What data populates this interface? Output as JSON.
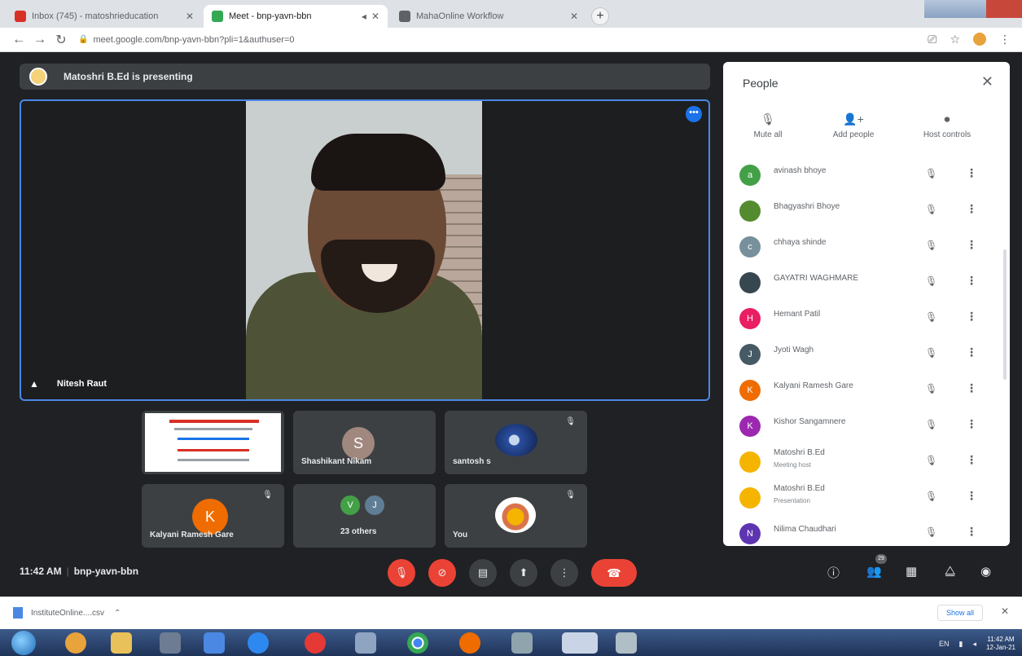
{
  "browser": {
    "tabs": [
      {
        "title": "Inbox (745) - matoshrieducation",
        "favicon_color": "#d93025",
        "active": false
      },
      {
        "title": "Meet - bnp-yavn-bbn",
        "favicon_color": "#34a853",
        "active": true
      },
      {
        "title": "MahaOnline Workflow",
        "favicon_color": "#5f6368",
        "active": false
      }
    ],
    "new_tab": "+",
    "url": "meet.google.com/bnp-yavn-bbn?pli=1&authuser=0"
  },
  "meet": {
    "presenting_text": "Matoshri B.Ed is presenting",
    "main_video_name": "Nitesh Raut",
    "tiles": [
      {
        "name": "",
        "kind": "slide"
      },
      {
        "name": "Shashikant Nikam",
        "initial": "S",
        "avatar_color": "#a1887f"
      },
      {
        "name": "santosh s",
        "kind": "photo"
      },
      {
        "name": "Kalyani Ramesh Gare",
        "initial": "K",
        "avatar_color": "#ef6c00"
      },
      {
        "name": "23 others",
        "initials": [
          "V",
          "J"
        ]
      },
      {
        "name": "You",
        "kind": "photo"
      }
    ],
    "time": "11:42 AM",
    "separator": "|",
    "meeting_code": "bnp-yavn-bbn",
    "participant_count": "29"
  },
  "people_panel": {
    "title": "People",
    "actions": [
      {
        "label": "Mute all",
        "icon": "mic-off-icon"
      },
      {
        "label": "Add people",
        "icon": "add-person-icon"
      },
      {
        "label": "Host controls",
        "icon": "host-controls-icon"
      }
    ],
    "participants": [
      {
        "name": "avinash bhoye",
        "initial": "a",
        "color": "#43a047",
        "sub": ""
      },
      {
        "name": "Bhagyashri Bhoye",
        "initial": "",
        "color": "#558b2f",
        "sub": ""
      },
      {
        "name": "chhaya shinde",
        "initial": "c",
        "color": "#78909c",
        "sub": ""
      },
      {
        "name": "GAYATRI WAGHMARE",
        "initial": "",
        "color": "#37474f",
        "sub": ""
      },
      {
        "name": "Hemant Patil",
        "initial": "H",
        "color": "#e91e63",
        "sub": ""
      },
      {
        "name": "Jyoti Wagh",
        "initial": "J",
        "color": "#455a64",
        "sub": ""
      },
      {
        "name": "Kalyani Ramesh Gare",
        "initial": "K",
        "color": "#ef6c00",
        "sub": ""
      },
      {
        "name": "Kishor Sangamnere",
        "initial": "K",
        "color": "#9c27b0",
        "sub": ""
      },
      {
        "name": "Matoshri B.Ed",
        "initial": "",
        "color": "#f4b400",
        "sub": "Meeting host"
      },
      {
        "name": "Matoshri B.Ed",
        "initial": "",
        "color": "#f4b400",
        "sub": "Presentation"
      },
      {
        "name": "Nilima Chaudhari",
        "initial": "N",
        "color": "#5e35b1",
        "sub": ""
      }
    ]
  },
  "downloads": {
    "file_name": "InstituteOnline....csv",
    "show_all": "Show all"
  },
  "taskbar": {
    "lang": "EN",
    "clock_time": "11:42 AM",
    "clock_date": "12-Jan-21"
  }
}
